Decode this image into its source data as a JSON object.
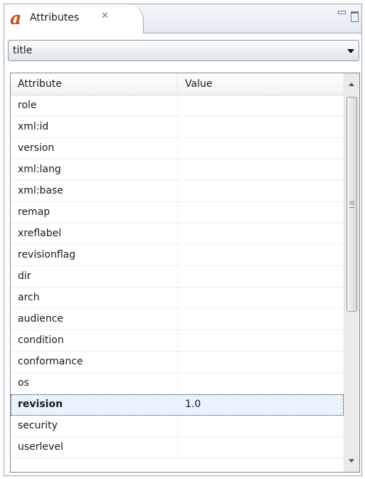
{
  "tab": {
    "icon": "a",
    "title": "Attributes",
    "close": "✕"
  },
  "element_combo": {
    "value": "title"
  },
  "table": {
    "columns": [
      "Attribute",
      "Value"
    ],
    "rows": [
      {
        "attribute": "role",
        "value": ""
      },
      {
        "attribute": "xml:id",
        "value": ""
      },
      {
        "attribute": "version",
        "value": ""
      },
      {
        "attribute": "xml:lang",
        "value": ""
      },
      {
        "attribute": "xml:base",
        "value": ""
      },
      {
        "attribute": "remap",
        "value": ""
      },
      {
        "attribute": "xreflabel",
        "value": ""
      },
      {
        "attribute": "revisionflag",
        "value": ""
      },
      {
        "attribute": "dir",
        "value": ""
      },
      {
        "attribute": "arch",
        "value": ""
      },
      {
        "attribute": "audience",
        "value": ""
      },
      {
        "attribute": "condition",
        "value": ""
      },
      {
        "attribute": "conformance",
        "value": ""
      },
      {
        "attribute": "os",
        "value": ""
      },
      {
        "attribute": "revision",
        "value": "1.0",
        "selected": true
      },
      {
        "attribute": "security",
        "value": ""
      },
      {
        "attribute": "userlevel",
        "value": ""
      }
    ]
  },
  "colors": {
    "tab_icon": "#d14a12",
    "selection": "#e8f3fd"
  }
}
